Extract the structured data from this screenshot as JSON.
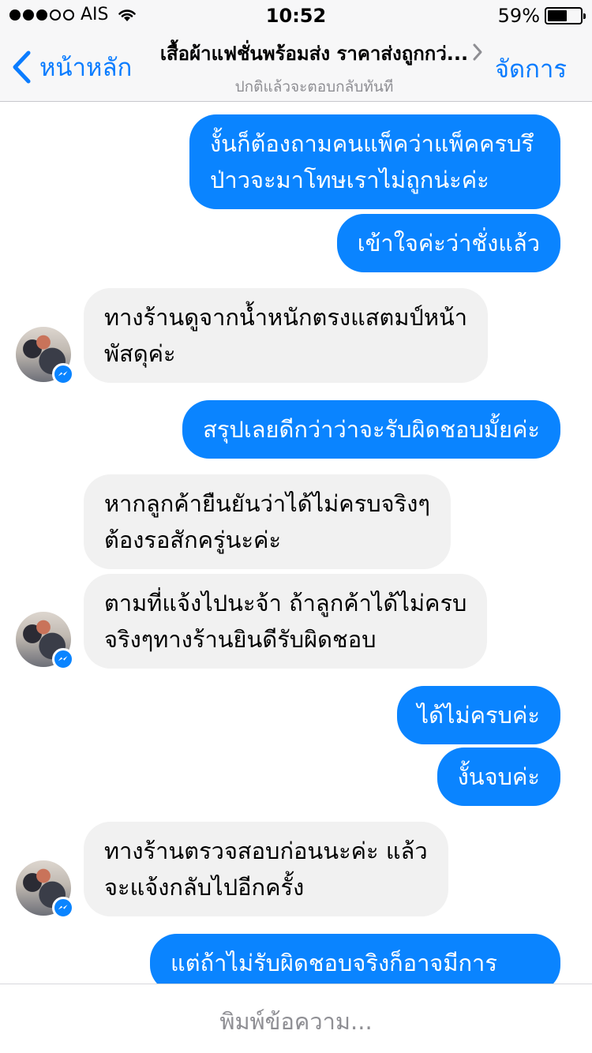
{
  "status": {
    "carrier": "AIS",
    "time": "10:52",
    "battery_text": "59%",
    "battery_level": 0.59
  },
  "nav": {
    "back_label": "หน้าหลัก",
    "title": "เสื้อผ้าแฟชั่นพร้อมส่ง ราคาส่งถูกกว่...",
    "subtitle": "ปกติแล้วจะตอบกลับทันที",
    "manage_label": "จัดการ"
  },
  "messages": [
    {
      "dir": "out",
      "lines": [
        "งั้นก็ต้องถามคนแพ็คว่าแพ็คครบรึ",
        "ป่าวจะมาโทษเราไม่ถูกน่ะค่ะ"
      ]
    },
    {
      "dir": "out",
      "lines": [
        "เข้าใจค่ะว่าชั่งแล้ว"
      ]
    },
    {
      "dir": "in",
      "lines": [
        "ทางร้านดูจากน้ำหนักตรงแสตมป์หน้า",
        "พัสดุค่ะ"
      ]
    },
    {
      "dir": "out",
      "lines": [
        "สรุปเลยดีกว่าว่าจะรับผิดชอบมั้ยค่ะ"
      ]
    },
    {
      "dir": "in",
      "lines": [
        "หากลูกค้ายืนยันว่าได้ไม่ครบจริงๆ",
        "ต้องรอสักครู่นะค่ะ"
      ]
    },
    {
      "dir": "in",
      "lines": [
        "ตามที่แจ้งไปนะจ้า ถ้าลูกค้าได้ไม่ครบ",
        "จริงๆทางร้านยินดีรับผิดชอบ"
      ]
    },
    {
      "dir": "out",
      "lines": [
        "ได้ไม่ครบค่ะ"
      ]
    },
    {
      "dir": "out",
      "lines": [
        "งั้นจบค่ะ"
      ]
    },
    {
      "dir": "in",
      "lines": [
        "ทางร้านตรวจสอบก่อนนะค่ะ แล้ว",
        "จะแจ้งกลับไปอีกครั้ง"
      ]
    },
    {
      "dir": "out",
      "lines": [
        "แต่ถ้าไม่รับผิดชอบจริงก็อาจมีการ"
      ]
    }
  ],
  "composer": {
    "placeholder": "พิมพ์ข้อความ..."
  },
  "colors": {
    "accent": "#0a7cff",
    "outgoing_bubble": "#0a84ff",
    "incoming_bubble": "#f1f1f1"
  },
  "icons": {
    "back": "chevron-left-icon",
    "title_more": "chevron-right-icon",
    "wifi": "wifi-icon",
    "battery": "battery-icon",
    "messenger_badge": "messenger-badge-icon"
  }
}
